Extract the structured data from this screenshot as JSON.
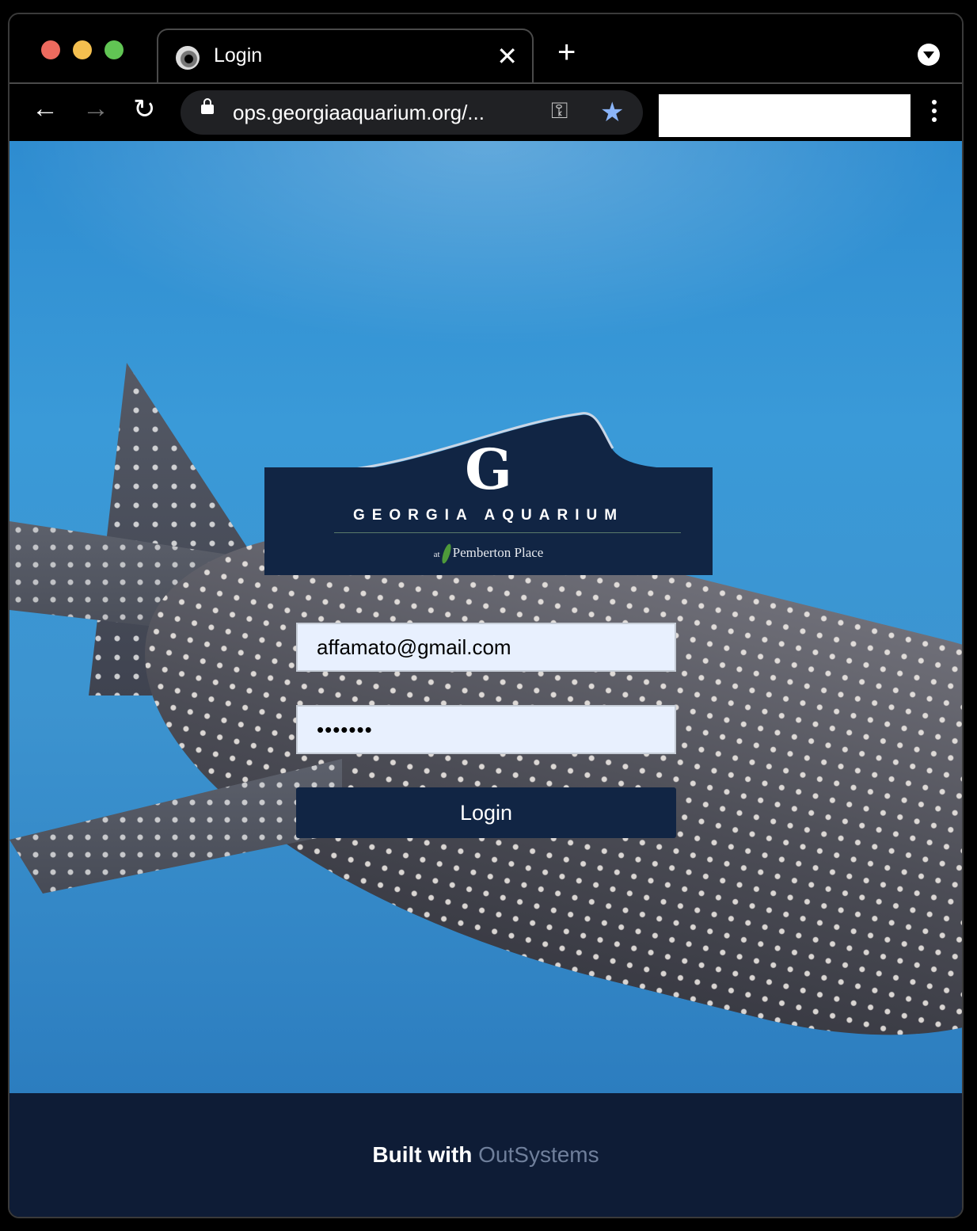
{
  "browser": {
    "tab_title": "Login",
    "tab_close": "✕",
    "new_tab": "+",
    "url": "ops.georgiaaquarium.org/...",
    "icons": {
      "back": "arrow-left-icon",
      "forward": "arrow-right-icon",
      "reload": "reload-icon",
      "lock": "lock-icon",
      "key": "key-icon",
      "star": "star-icon",
      "menu": "more-vertical-icon"
    }
  },
  "logo": {
    "mark": "G",
    "name": "GEORGIA AQUARIUM",
    "sub_at": "at",
    "sub_place": "Pemberton Place"
  },
  "form": {
    "email_value": "affamato@gmail.com",
    "password_value": "•••••••",
    "login_label": "Login"
  },
  "footer": {
    "built_with": "Built with",
    "brand": "OutSystems"
  },
  "colors": {
    "navy": "#112544",
    "footer_bg": "#0e1c36",
    "field_bg": "#e8f0fe",
    "star_blue": "#8ab4f8"
  }
}
